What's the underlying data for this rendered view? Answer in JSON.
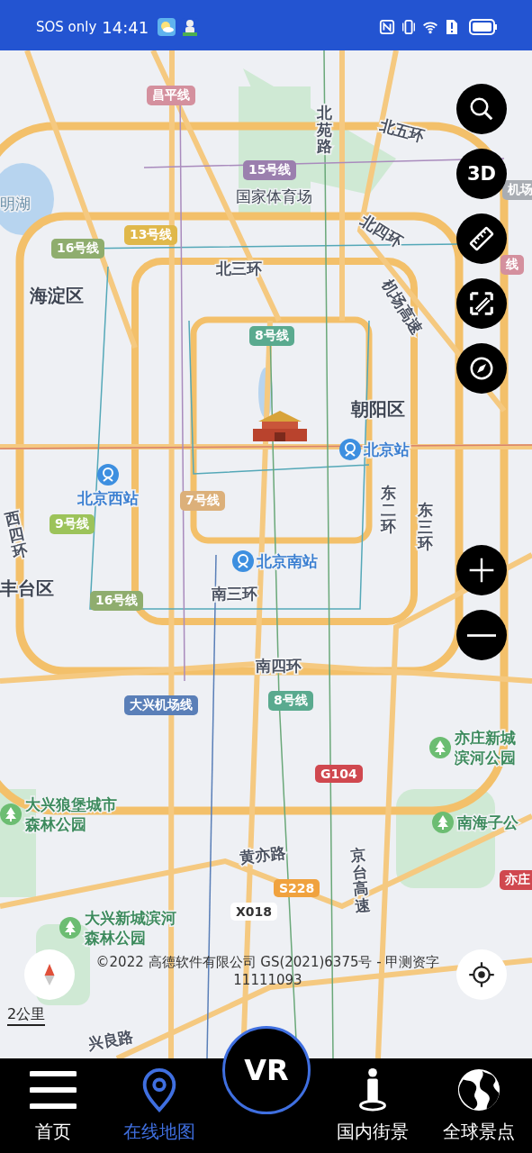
{
  "status_bar": {
    "carrier": "SOS only",
    "time": "14:41"
  },
  "map": {
    "labels": [
      {
        "kind": "badge",
        "text": "昌平线",
        "color": "#d4909e"
      },
      {
        "kind": "road",
        "text": "北苑路"
      },
      {
        "kind": "road",
        "text": "北五环"
      },
      {
        "kind": "badge",
        "text": "15号线",
        "color": "#9b7fae"
      },
      {
        "kind": "poi",
        "text": "国家体育场"
      },
      {
        "kind": "water",
        "text": "明湖"
      },
      {
        "kind": "road",
        "text": "北四环"
      },
      {
        "kind": "badge",
        "text": "机场",
        "color": "#a9adb3"
      },
      {
        "kind": "badge",
        "text": "13号线",
        "color": "#e0b84a"
      },
      {
        "kind": "badge",
        "text": "16号线",
        "color": "#8fad6e"
      },
      {
        "kind": "badge",
        "text": "线",
        "color": "#d4909e"
      },
      {
        "kind": "road",
        "text": "北三环"
      },
      {
        "kind": "road",
        "text": "机场高速"
      },
      {
        "kind": "district",
        "text": "海淀区"
      },
      {
        "kind": "badge",
        "text": "8号线",
        "color": "#5aaa8f"
      },
      {
        "kind": "district",
        "text": "朝阳区"
      },
      {
        "kind": "station",
        "text": "北京站"
      },
      {
        "kind": "station",
        "text": "北京西站"
      },
      {
        "kind": "badge",
        "text": "7号线",
        "color": "#dcb07a"
      },
      {
        "kind": "road",
        "text": "东二环"
      },
      {
        "kind": "road",
        "text": "东三环"
      },
      {
        "kind": "road",
        "text": "西四环"
      },
      {
        "kind": "badge",
        "text": "9号线",
        "color": "#9cc35a"
      },
      {
        "kind": "station",
        "text": "北京南站"
      },
      {
        "kind": "district",
        "text": "丰台区"
      },
      {
        "kind": "badge",
        "text": "16号线",
        "color": "#8fad6e"
      },
      {
        "kind": "road",
        "text": "南三环"
      },
      {
        "kind": "road",
        "text": "南四环"
      },
      {
        "kind": "badge",
        "text": "大兴机场线",
        "color": "#5a7fb8"
      },
      {
        "kind": "badge",
        "text": "8号线",
        "color": "#5aaa8f"
      },
      {
        "kind": "park",
        "text": "亦庄新城滨河公园"
      },
      {
        "kind": "badge",
        "text": "G104",
        "color": "#d0484f"
      },
      {
        "kind": "park",
        "text": "大兴狼堡城市森林公园"
      },
      {
        "kind": "park",
        "text": "南海子公"
      },
      {
        "kind": "road",
        "text": "黄亦路"
      },
      {
        "kind": "road",
        "text": "京台高速"
      },
      {
        "kind": "badge",
        "text": "S228",
        "color": "#f0a23e"
      },
      {
        "kind": "badge",
        "text": "亦庄",
        "color": "#d0484f"
      },
      {
        "kind": "badge",
        "text": "X018",
        "color": "#ffffff"
      },
      {
        "kind": "park",
        "text": "大兴新城滨河森林公园"
      },
      {
        "kind": "road",
        "text": "兴良路"
      }
    ],
    "copyright": "©2022 高德软件有限公司 GS(2021)6375号 - 甲测资字11111093",
    "scale": "2公里"
  },
  "map_controls": {
    "mode_button": "3D"
  },
  "vr_button": "VR",
  "bottom_nav": [
    {
      "label": "首页",
      "selected": false
    },
    {
      "label": "在线地图",
      "selected": true
    },
    {
      "label": "国内街景",
      "selected": false
    },
    {
      "label": "全球景点",
      "selected": false
    }
  ]
}
